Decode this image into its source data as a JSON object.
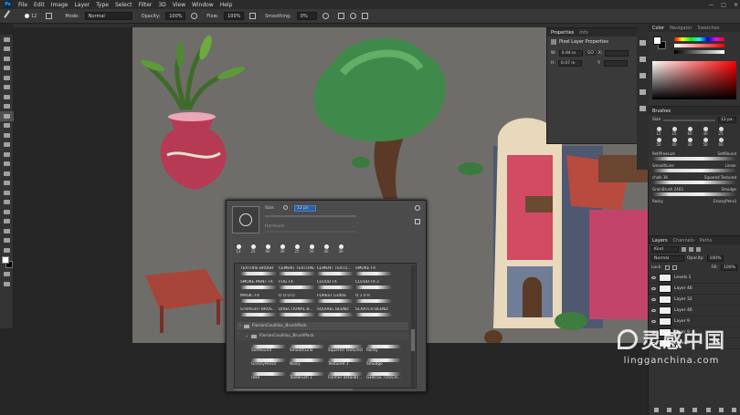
{
  "menu": {
    "ps_label": "Ps",
    "items": [
      "File",
      "Edit",
      "Image",
      "Layer",
      "Type",
      "Select",
      "Filter",
      "3D",
      "View",
      "Window",
      "Help"
    ]
  },
  "window_controls": {
    "minimize": "—",
    "maximize": "□",
    "close": "✕"
  },
  "options_bar": {
    "brush_size": "12",
    "mode_label": "Mode:",
    "mode_value": "Normal",
    "opacity_label": "Opacity:",
    "opacity_value": "100%",
    "flow_label": "Flow:",
    "flow_value": "100%",
    "smoothing_label": "Smoothing:",
    "smoothing_value": "0%"
  },
  "properties": {
    "tabs": [
      "Properties",
      "Info"
    ],
    "title": "Pixel Layer Properties",
    "w_label": "W:",
    "w_value": "0.94 in",
    "go_label": "GO",
    "x_label": "X:",
    "y_label": "Y:",
    "h_label": "H:",
    "h_value": "0.07 in"
  },
  "color_panel": {
    "tabs": [
      "Color",
      "Navigator",
      "Swatches"
    ],
    "fg": "#ffffff",
    "bg": "#000000"
  },
  "brushes_panel": {
    "tab": "Brushes",
    "size_label": "Size",
    "size_value": "12 px",
    "sizes": [
      "12",
      "25",
      "60",
      "30",
      "25",
      "50",
      "40",
      "30",
      "50",
      "60"
    ],
    "names": [
      [
        "Ref/Pressure",
        "SoftRound"
      ],
      [
        "SmoothLine",
        "Linear"
      ],
      [
        "chalk 36",
        "Squared Textured"
      ],
      [
        "GrainBrush 2403",
        "Smudge"
      ],
      [
        "Rocky",
        "GrassyPencil"
      ]
    ]
  },
  "layers_panel": {
    "tabs": [
      "Layers",
      "Channels",
      "Paths"
    ],
    "kind_label": "Kind",
    "blend_value": "Normal",
    "opacity_label": "Opacity:",
    "opacity_value": "100%",
    "lock_label": "Lock:",
    "fill_label": "Fill:",
    "fill_value": "100%",
    "layers": [
      "Levels 1",
      "Layer 46",
      "Layer 32",
      "Layer 46",
      "Layer 9",
      "Layer 9",
      "Layer 3"
    ]
  },
  "brush_picker": {
    "size_label": "Size:",
    "size_value": "12 px",
    "hardness_label": "Hardness:",
    "preset_sizes": [
      "12",
      "25",
      "60",
      "30",
      "25",
      "50",
      "40",
      "30"
    ],
    "grid": [
      [
        "TEXTURE BRUSH",
        "CEMENT TEXTURE",
        "CEMENT TEXTU...",
        "SMOKE FX"
      ],
      [
        "SMOKE PAINT FX",
        "FOG FX",
        "CLOUD FX",
        "CLOUD FX 2"
      ],
      [
        "MAGIC FX",
        "O O O O",
        "FOREST  GUIDE",
        "O  1  0  R"
      ],
      [
        "STRAIGHT BRUS...",
        "DIRECTIONAL B...",
        "SQUIREL BLEND",
        "SCRATCH BLEND"
      ]
    ],
    "group_name": "FlorianCouilliac_BrushPack",
    "subgroup_name": "FlorianCouilliac_BrushPack",
    "sub_grid": [
      [
        "SoftRound",
        "SmoothLine",
        "Squared Textured",
        "Rocky"
      ],
      [
        "GrassyPencil",
        "Noisy",
        "Textured 1",
        "Smudge"
      ],
      [
        "rake",
        "ToolBrush 1",
        "Former  detailBr...",
        "GENTLE TOUCH..."
      ]
    ]
  },
  "watermark": {
    "brand": "灵感中国",
    "url": "lingganchina.com"
  }
}
